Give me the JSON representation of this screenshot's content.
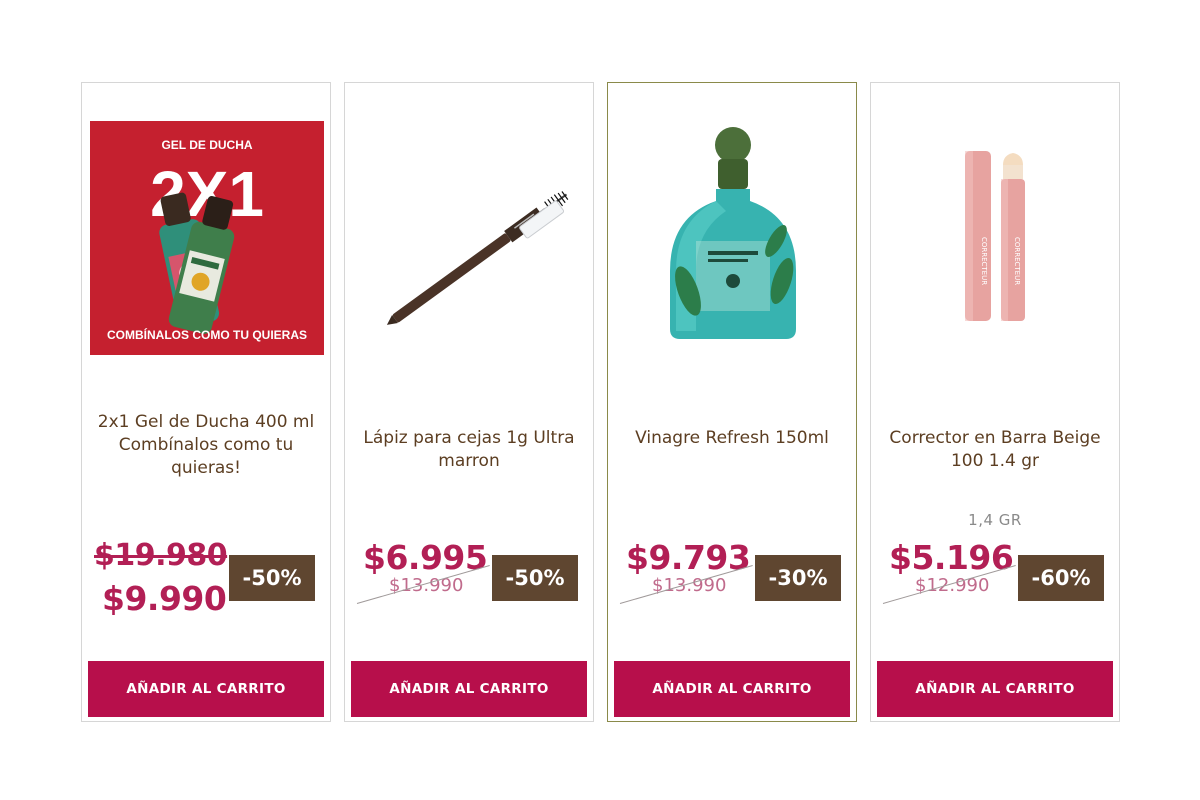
{
  "products": [
    {
      "title": "2x1 Gel de Ducha 400 ml Combínalos como tu quieras!",
      "price_old": "$19.980",
      "price_new": "$9.990",
      "discount": "-50%",
      "cart_label": "AÑADIR AL CARRITO",
      "promo": {
        "top": "GEL DE DUCHA",
        "big": "2X1",
        "bottom": "COMBÍNALOS COMO TU QUIERAS"
      }
    },
    {
      "title": "Lápiz para cejas 1g Ultra marron",
      "price_new": "$6.995",
      "price_old": "$13.990",
      "discount": "-50%",
      "cart_label": "AÑADIR AL CARRITO"
    },
    {
      "title": "Vinagre Refresh 150ml",
      "price_new": "$9.793",
      "price_old": "$13.990",
      "discount": "-30%",
      "cart_label": "AÑADIR AL CARRITO"
    },
    {
      "title": "Corrector en Barra Beige 100 1.4 gr",
      "size": "1,4 GR",
      "price_new": "$5.196",
      "price_old": "$12.990",
      "discount": "-60%",
      "cart_label": "AÑADIR AL CARRITO"
    }
  ],
  "colors": {
    "accent": "#b70f4b",
    "price": "#b21f55",
    "badge": "#5f4630",
    "title": "#5c3e22"
  }
}
